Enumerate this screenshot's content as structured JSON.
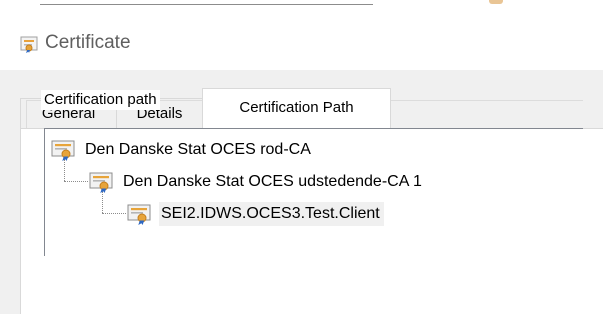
{
  "window": {
    "title": "Certificate"
  },
  "tabs": [
    {
      "label": "General",
      "active": false
    },
    {
      "label": "Details",
      "active": false
    },
    {
      "label": "Certification Path",
      "active": true
    }
  ],
  "certification_path": {
    "group_label": "Certification path",
    "selected_index": 2,
    "items": [
      {
        "label": "Den Danske Stat OCES rod-CA",
        "level": 0,
        "icon": "certificate-icon"
      },
      {
        "label": "Den Danske Stat OCES udstedende-CA 1",
        "level": 1,
        "icon": "certificate-icon"
      },
      {
        "label": "SEI2.IDWS.OCES3.Test.Client",
        "level": 2,
        "icon": "certificate-icon"
      }
    ]
  },
  "colors": {
    "certificate_body": "#f2f2f2",
    "certificate_seal": "#e7a43a",
    "certificate_ribbon": "#2d68c4",
    "selection_background": "#f0f0f0"
  }
}
